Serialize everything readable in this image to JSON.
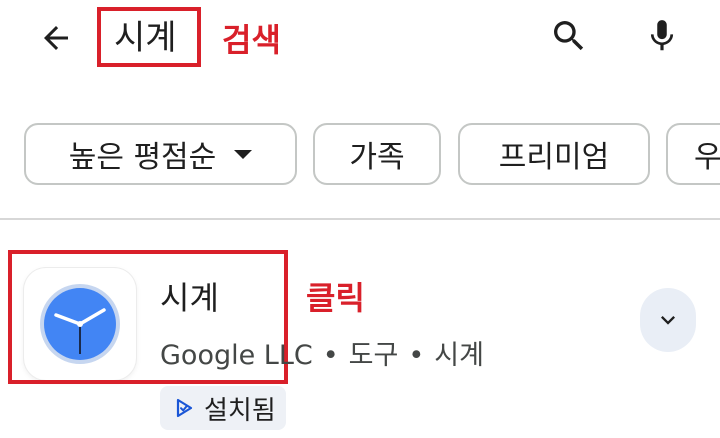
{
  "search": {
    "query": "시계",
    "annotation": "검색"
  },
  "filters": {
    "chips": [
      {
        "label": "높은 평점순",
        "has_dropdown": true
      },
      {
        "label": "가족"
      },
      {
        "label": "프리미엄"
      },
      {
        "label": "우"
      }
    ]
  },
  "app": {
    "name": "시계",
    "annotation": "클릭",
    "developer": "Google LLC",
    "category": "도구",
    "tag": "시계",
    "separator": "•",
    "installed_label": "설치됨"
  },
  "icons": {
    "back": "arrow-left-icon",
    "search": "search-icon",
    "mic": "microphone-icon",
    "expand": "chevron-down-icon",
    "installed": "play-installed-icon",
    "app": "clock-app-icon"
  },
  "colors": {
    "annotation_red": "#d9202a",
    "clock_blue": "#4285f4",
    "badge_bg": "#eef1f6"
  }
}
